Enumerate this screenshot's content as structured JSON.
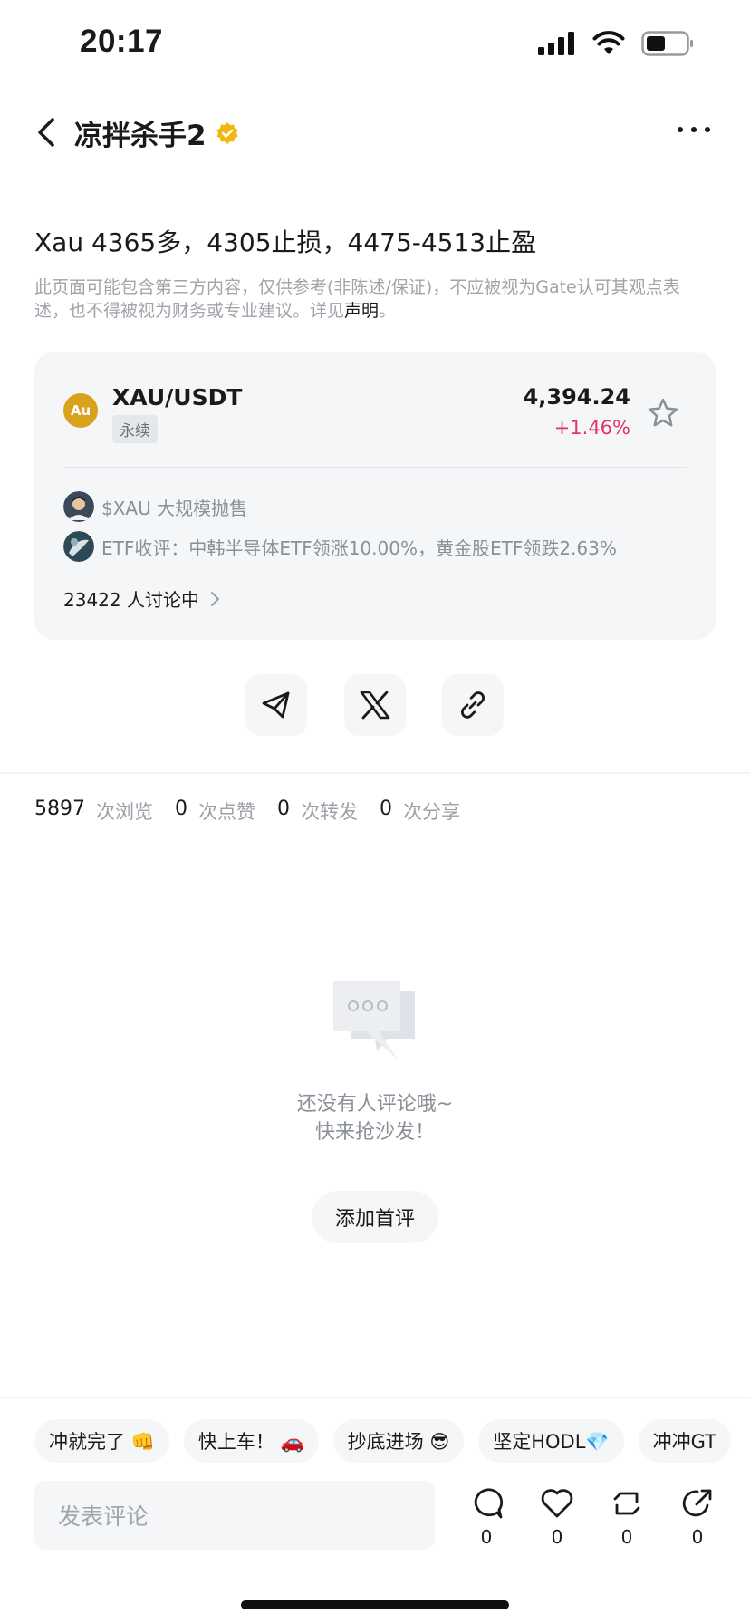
{
  "status_bar": {
    "time": "20:17"
  },
  "header": {
    "author": "凉拌杀手2"
  },
  "post": {
    "text": "Xau 4365多，4305止损，4475-4513止盈",
    "disclaimer": "此页面可能包含第三方内容，仅供参考(非陈述/保证)，不应被视为Gate认可其观点表述，也不得被视为财务或专业建议。详见",
    "disclaimer_link": "声明",
    "disclaimer_end": "。"
  },
  "market_card": {
    "coin_symbol": "Au",
    "pair": "XAU/USDT",
    "type_tag": "永续",
    "price": "4,394.24",
    "change": "+1.46%",
    "news": [
      {
        "text": "$XAU 大规模抛售"
      },
      {
        "text": "ETF收评：中韩半导体ETF领涨10.00%，黄金股ETF领跌2.63%"
      }
    ],
    "discussion": "23422 人讨论中"
  },
  "stats": {
    "views": "5897",
    "views_label": "次浏览",
    "likes": "0",
    "likes_label": "次点赞",
    "reposts": "0",
    "reposts_label": "次转发",
    "shares": "0",
    "shares_label": "次分享"
  },
  "empty_state": {
    "line1": "还没有人评论哦~",
    "line2": "快来抢沙发！",
    "button": "添加首评"
  },
  "quick_replies": [
    "冲就完了 👊",
    "快上车！ 🚗",
    "抄底进场 😎",
    "坚定HODL💎",
    "冲冲GT"
  ],
  "comment_bar": {
    "placeholder": "发表评论",
    "comment_count": "0",
    "like_count": "0",
    "repost_count": "0",
    "share_count": "0"
  },
  "colors": {
    "positive_change": "#e5326e",
    "verified_badge": "#f0b90b",
    "coin_badge": "#d9a21b"
  }
}
